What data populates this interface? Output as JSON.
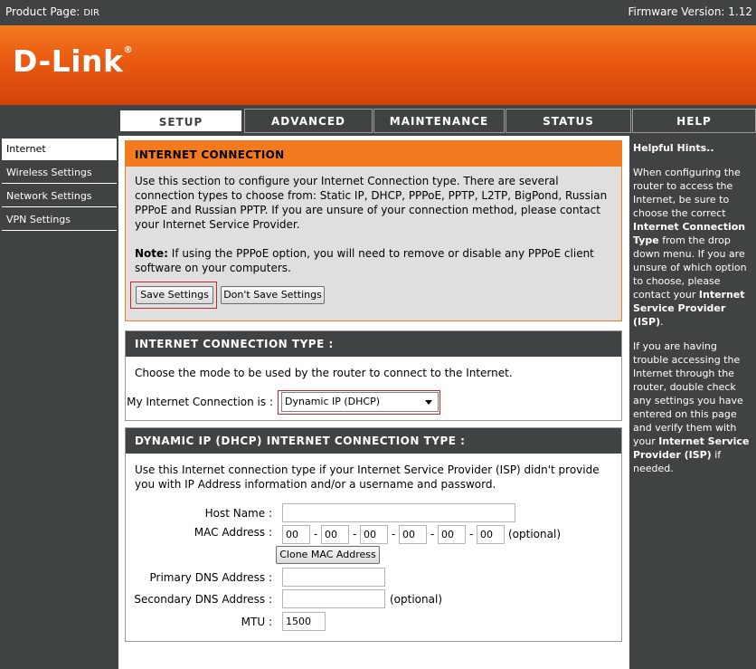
{
  "header": {
    "product_label": "Product Page:",
    "product_value": "DIR",
    "firmware": "Firmware Version: 1.12",
    "logo": "D-Link"
  },
  "tabs": [
    "SETUP",
    "ADVANCED",
    "MAINTENANCE",
    "STATUS",
    "HELP"
  ],
  "sidebar": [
    "Internet",
    "Wireless Settings",
    "Network Settings",
    "VPN Settings"
  ],
  "internet_connection": {
    "title": "INTERNET CONNECTION",
    "intro": "Use this section to configure your Internet Connection type. There are several connection types to choose from: Static IP, DHCP, PPPoE, PPTP, L2TP, BigPond, Russian PPPoE and Russian PPTP. If you are unsure of your connection method, please contact your Internet Service Provider.",
    "note_label": "Note:",
    "note_text": " If using the PPPoE option, you will need to remove or disable any PPPoE client software on your computers.",
    "save_label": "Save Settings",
    "dont_save_label": "Don't Save Settings"
  },
  "connection_type": {
    "title": "INTERNET CONNECTION TYPE :",
    "description": "Choose the mode to be used by the router to connect to the Internet.",
    "my_connection_label": "My Internet Connection is :",
    "selected": "Dynamic IP (DHCP)"
  },
  "dhcp": {
    "title": "DYNAMIC IP (DHCP) INTERNET CONNECTION TYPE :",
    "description": "Use this Internet connection type if your Internet Service Provider (ISP) didn't provide you with IP Address information and/or a username and password.",
    "host_name_label": "Host Name :",
    "host_name_value": "",
    "mac_label": "MAC Address :",
    "mac": [
      "00",
      "00",
      "00",
      "00",
      "00",
      "00"
    ],
    "mac_separator": "-",
    "optional": "(optional)",
    "clone_label": "Clone MAC Address",
    "primary_dns_label": "Primary DNS Address :",
    "primary_dns_value": "",
    "secondary_dns_label": "Secondary DNS Address :",
    "secondary_dns_value": "",
    "mtu_label": "MTU :",
    "mtu_value": "1500"
  },
  "help": {
    "title": "Helpful Hints..",
    "p1_a": "When configuring the router to access the Internet, be sure to choose the correct ",
    "p1_b": "Internet Connection Type",
    "p1_c": " from the drop down menu. If you are unsure of which option to choose, please contact your ",
    "p1_d": "Internet Service Provider (ISP)",
    "p1_e": ".",
    "p2_a": "If you are having trouble accessing the Internet through the router, double check any settings you have entered on this page and verify them with your ",
    "p2_b": "Internet Service Provider (ISP)",
    "p2_c": " if needed."
  },
  "colors": {
    "accent": "#f47a1f",
    "dark": "#404343",
    "highlight_frame": "#c0262b"
  }
}
